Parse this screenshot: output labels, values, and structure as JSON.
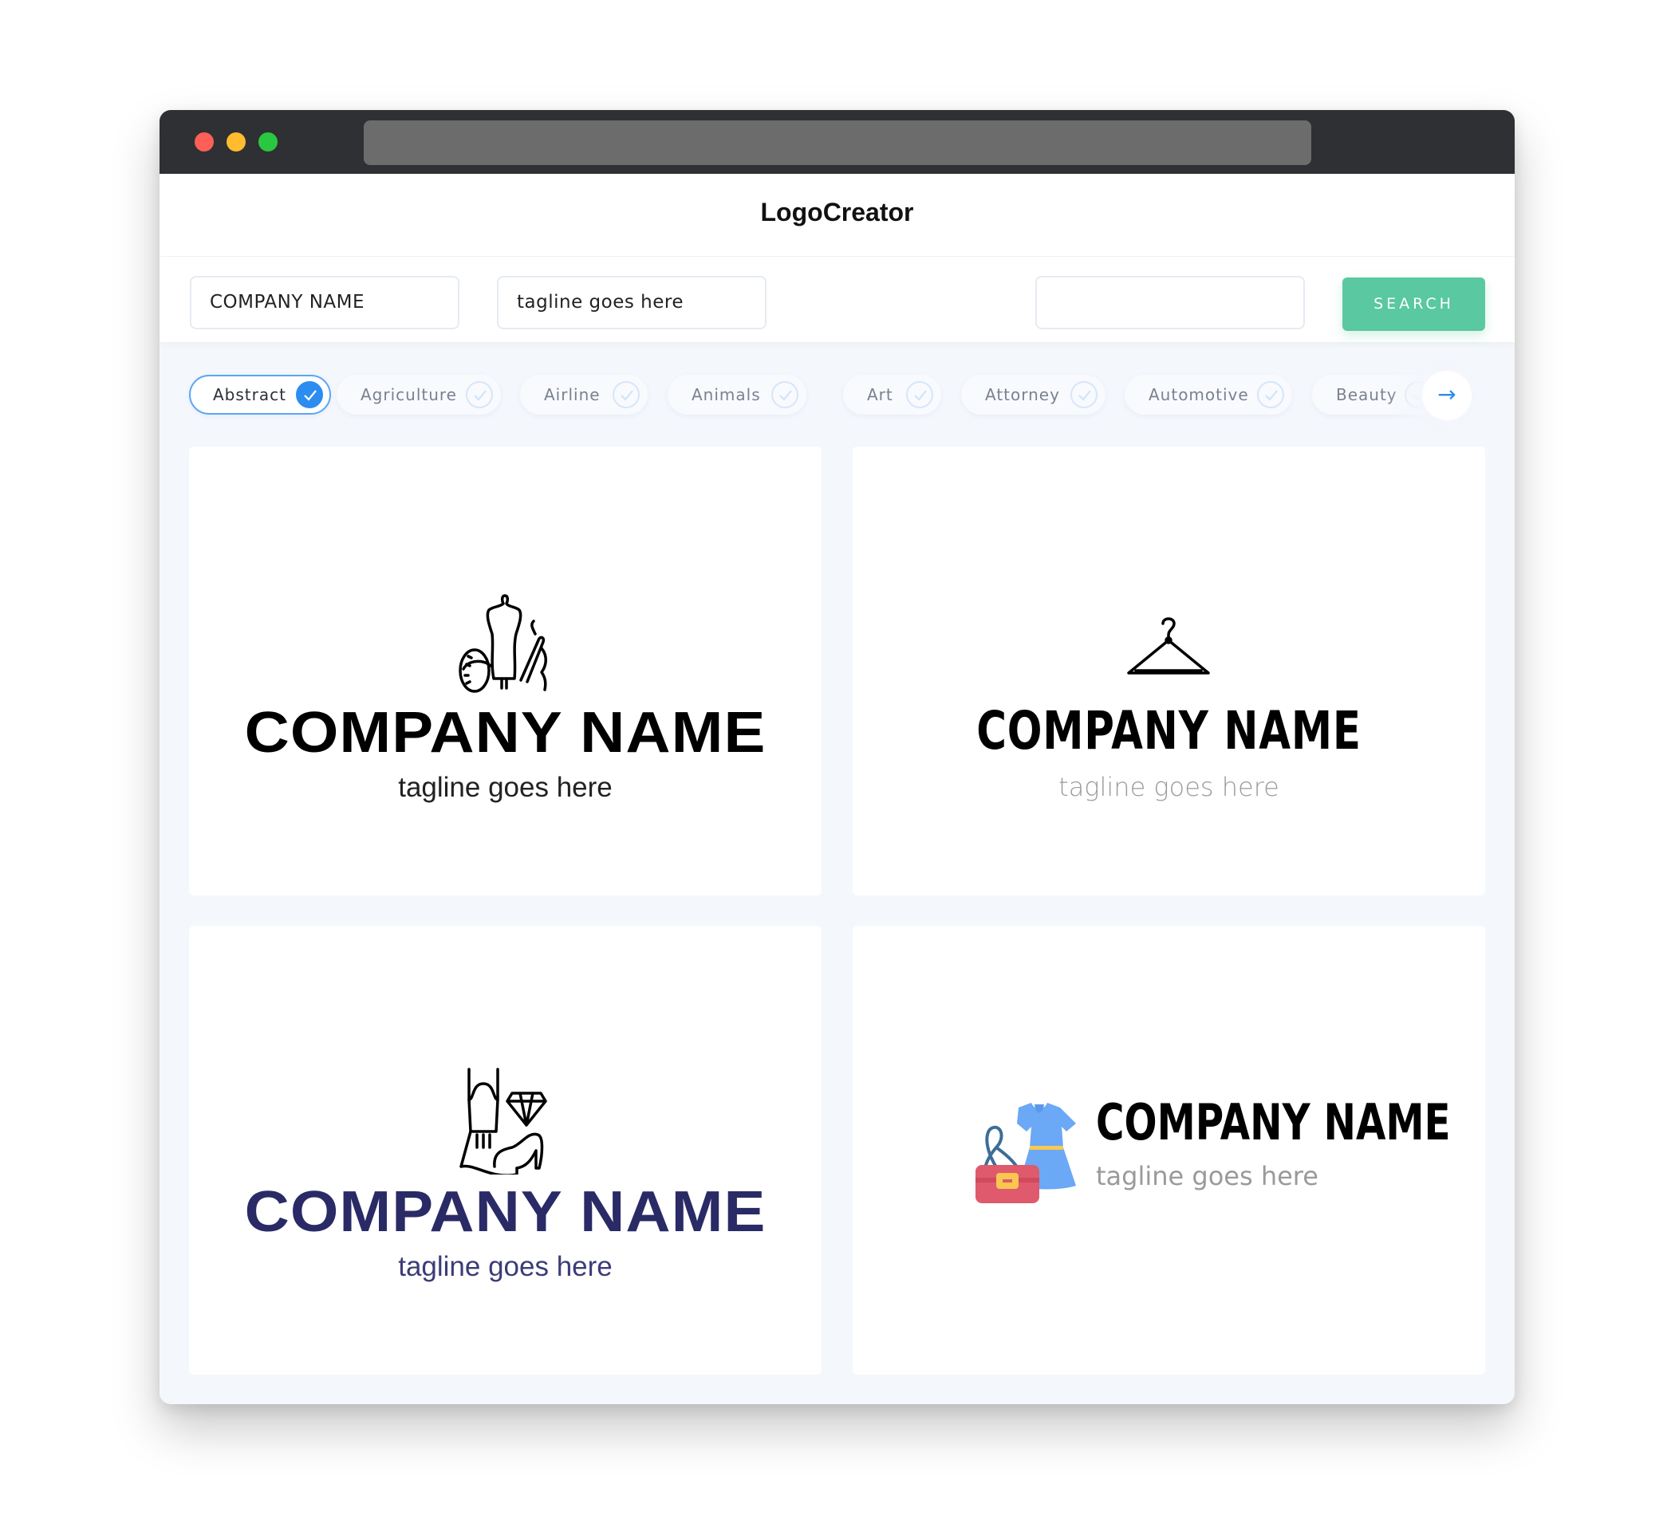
{
  "window": {
    "controls": [
      "close",
      "minimize",
      "maximize"
    ],
    "url": ""
  },
  "header": {
    "title": "LogoCreator"
  },
  "search": {
    "company_value": "COMPANY NAME",
    "tagline_value": "tagline goes here",
    "keyword_value": "",
    "button_label": "SEARCH",
    "accent_color": "#5ac8a0"
  },
  "filters": {
    "items": [
      {
        "label": "Abstract",
        "selected": true
      },
      {
        "label": "Agriculture",
        "selected": false
      },
      {
        "label": "Airline",
        "selected": false
      },
      {
        "label": "Animals",
        "selected": false
      },
      {
        "label": "Art",
        "selected": false
      },
      {
        "label": "Attorney",
        "selected": false
      },
      {
        "label": "Automotive",
        "selected": false
      },
      {
        "label": "Beauty",
        "selected": false
      }
    ],
    "next_icon": "arrow-right-icon",
    "selected_color": "#2d8cf0"
  },
  "logos": [
    {
      "icon": "mannequin-sewing-icon",
      "name": "COMPANY NAME",
      "tagline": "tagline goes here",
      "name_color": "#000000"
    },
    {
      "icon": "clothes-hanger-icon",
      "name": "COMPANY NAME",
      "tagline": "tagline goes here",
      "name_color": "#000000"
    },
    {
      "icon": "dress-diamond-heel-icon",
      "name": "COMPANY NAME",
      "tagline": "tagline goes here",
      "name_color": "#2a2a66"
    },
    {
      "icon": "dress-handbag-icon",
      "name": "COMPANY NAME",
      "tagline": "tagline goes here",
      "name_color": "#000000"
    }
  ]
}
